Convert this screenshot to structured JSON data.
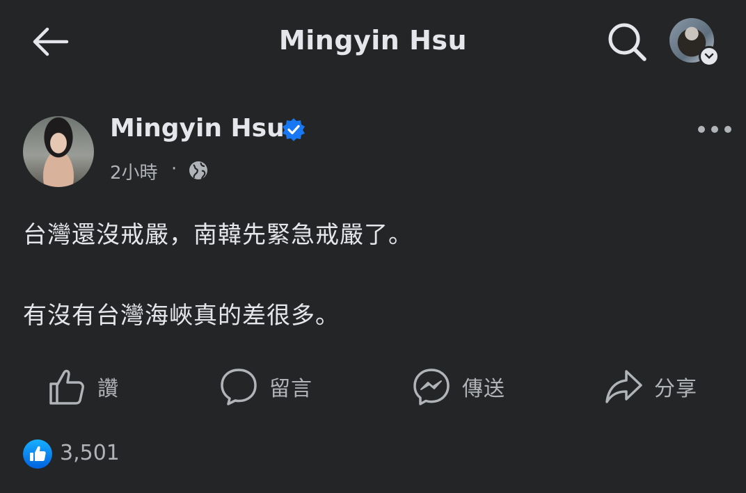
{
  "header": {
    "title": "Mingyin Hsu",
    "back_icon": "back-arrow-icon",
    "search_icon": "search-icon"
  },
  "post": {
    "author": "Mingyin Hsu",
    "verified": true,
    "time": "2小時",
    "separator": "·",
    "audience_icon": "globe-icon",
    "text_lines": [
      "台灣還沒戒嚴，南韓先緊急戒嚴了。",
      "有沒有台灣海峽真的差很多。"
    ]
  },
  "actions": {
    "like": "讚",
    "comment": "留言",
    "send": "傳送",
    "share": "分享"
  },
  "reactions": {
    "count": "3,501",
    "icon": "like-reaction-icon"
  },
  "colors": {
    "background": "#242526",
    "text": "#e4e6eb",
    "secondary_text": "#b0b3b8",
    "accent_blue": "#1877f2"
  }
}
